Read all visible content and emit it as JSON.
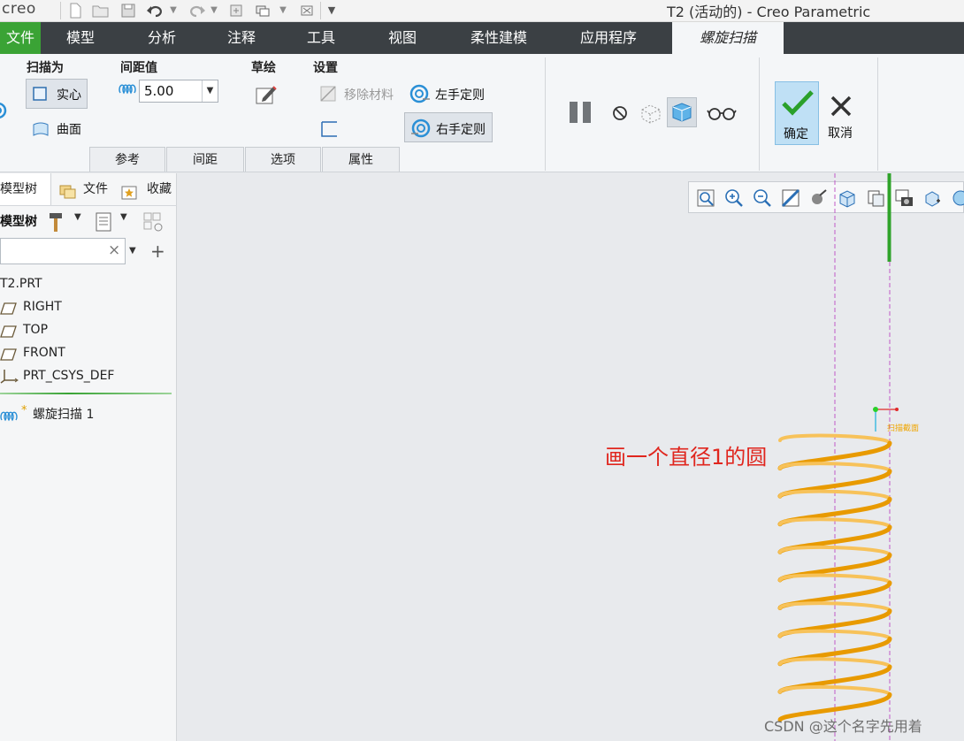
{
  "window": {
    "logo": "creo",
    "title": "T2 (活动的) - Creo Parametric"
  },
  "tabs": [
    {
      "label": "文件"
    },
    {
      "label": "模型"
    },
    {
      "label": "分析"
    },
    {
      "label": "注释"
    },
    {
      "label": "工具"
    },
    {
      "label": "视图"
    },
    {
      "label": "柔性建模"
    },
    {
      "label": "应用程序"
    },
    {
      "label": "螺旋扫描"
    }
  ],
  "ribbon": {
    "sweep_as": {
      "title": "扫描为",
      "solid": "实心",
      "surface": "曲面"
    },
    "pitch": {
      "title": "间距值",
      "value": "5.00"
    },
    "sketch": {
      "title": "草绘"
    },
    "settings": {
      "title": "设置",
      "remove_material": "移除材料",
      "left_handed": "左手定则",
      "right_handed": "右手定则"
    },
    "ok": "确定",
    "cancel": "取消",
    "subtabs": [
      "参考",
      "间距",
      "选项",
      "属性"
    ]
  },
  "left_panel": {
    "tabs": [
      "模型树",
      "文件",
      "收藏"
    ],
    "toolbar_label": "模型树",
    "tree": [
      {
        "label": "T2.PRT",
        "icon": "part-icon"
      },
      {
        "label": "RIGHT",
        "icon": "datum-plane-icon"
      },
      {
        "label": "TOP",
        "icon": "datum-plane-icon"
      },
      {
        "label": "FRONT",
        "icon": "datum-plane-icon"
      },
      {
        "label": "PRT_CSYS_DEF",
        "icon": "csys-icon"
      },
      {
        "label": "螺旋扫描 1",
        "icon": "helix-icon",
        "marker": "*"
      }
    ]
  },
  "canvas": {
    "annotation": "画一个直径1的圆",
    "section_label": "扫描截面",
    "watermark": "CSDN @这个名字先用着"
  },
  "colors": {
    "file_tab": "#3aa335",
    "ribbon_dark": "#3b4044",
    "spring": "#f0a500",
    "annotation": "#e0261e"
  }
}
